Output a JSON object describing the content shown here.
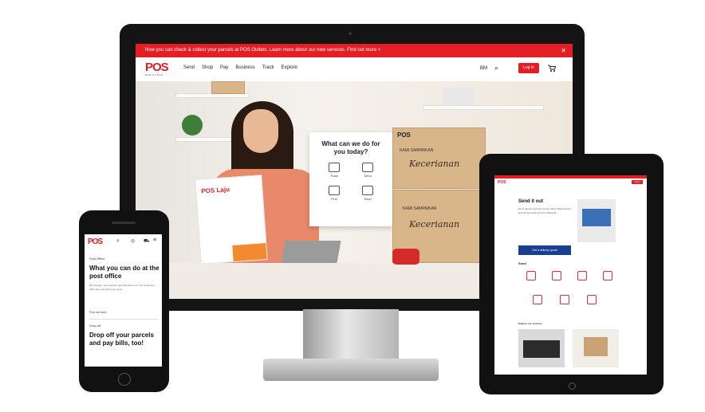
{
  "desktop": {
    "promo_bar": {
      "text": "Now you can check & collect your parcels at POS Outlets. Learn more about our new services. Find out more >",
      "close_icon": "close-icon"
    },
    "logo": {
      "text": "POS",
      "sub": "MALAYSIA"
    },
    "nav": [
      "Send",
      "Shop",
      "Pay",
      "Business",
      "Track",
      "Explore"
    ],
    "lang": "BM",
    "login_label": "Log In",
    "icons": [
      "search-icon",
      "cart-icon"
    ],
    "popup": {
      "title": "What can we do for you today?",
      "items": [
        {
          "label": "Track",
          "icon": "track-icon"
        },
        {
          "label": "Send",
          "icon": "send-icon"
        },
        {
          "label": "Find",
          "icon": "find-icon"
        },
        {
          "label": "Shop",
          "icon": "shop-icon"
        }
      ]
    },
    "box_labels": [
      "POS",
      "KAMI SAMPAIKAN",
      "Kecerianan",
      "KAMI SAMPAIKAN",
      "Kecerianan"
    ],
    "mailer_text": "POS Laju"
  },
  "tablet": {
    "heading": "Send it out",
    "body": "Send parcels and documents within Malaysia and around the world with Pos Malaysia.",
    "cta": "Get a delivery quote",
    "section_label": "Send",
    "explore_label": "Explore our services",
    "login_label": "Log In"
  },
  "phone": {
    "logo": "POS",
    "breadcrumb": "Post Office",
    "heading1": "What you can do at the post office",
    "body": "Buy stamps, send parcels, pay bills and more. Your local post office has everything you need.",
    "link": "Find out more",
    "section_label": "Drop off",
    "heading2": "Drop off your parcels and pay bills, too!"
  }
}
